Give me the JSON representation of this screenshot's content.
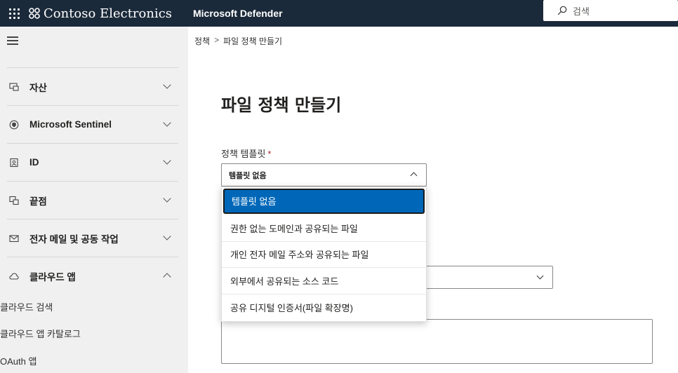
{
  "header": {
    "brand": "Contoso Electronics",
    "product": "Microsoft Defender",
    "search_placeholder": "검색"
  },
  "sidebar": {
    "items": [
      {
        "label": "자산",
        "icon": "devices-icon",
        "expanded": false
      },
      {
        "label": "Microsoft Sentinel",
        "icon": "shield-icon",
        "expanded": false
      },
      {
        "label": "ID",
        "icon": "id-card-icon",
        "expanded": false
      },
      {
        "label": "끝점",
        "icon": "endpoints-icon",
        "expanded": false
      },
      {
        "label": "전자 메일 및 공동 작업",
        "icon": "mail-icon",
        "expanded": false
      },
      {
        "label": "클라우드 앱",
        "icon": "cloud-icon",
        "expanded": true
      }
    ],
    "subitems": [
      "클라우드 검색",
      "클라우드 앱 카탈로그",
      "OAuth 앱"
    ]
  },
  "breadcrumb": {
    "parent": "정책",
    "current": "파일 정책 만들기"
  },
  "page": {
    "title": "파일 정책 만들기"
  },
  "form": {
    "template_label": "정책 템플릿",
    "required_mark": "*",
    "template_value": "템플릿 없음",
    "template_options": [
      "템플릿 없음",
      "권한 없는 도메인과 공유되는 파일",
      "개인 전자 메일 주소와 공유되는 파일",
      "외부에서 공유되는 소스 코드",
      "공유 디지털 인증서(파일 확장명)"
    ]
  },
  "colors": {
    "topbar": "#1b2a3a",
    "accent": "#0067b8",
    "sidebar": "#f0f0f0"
  }
}
